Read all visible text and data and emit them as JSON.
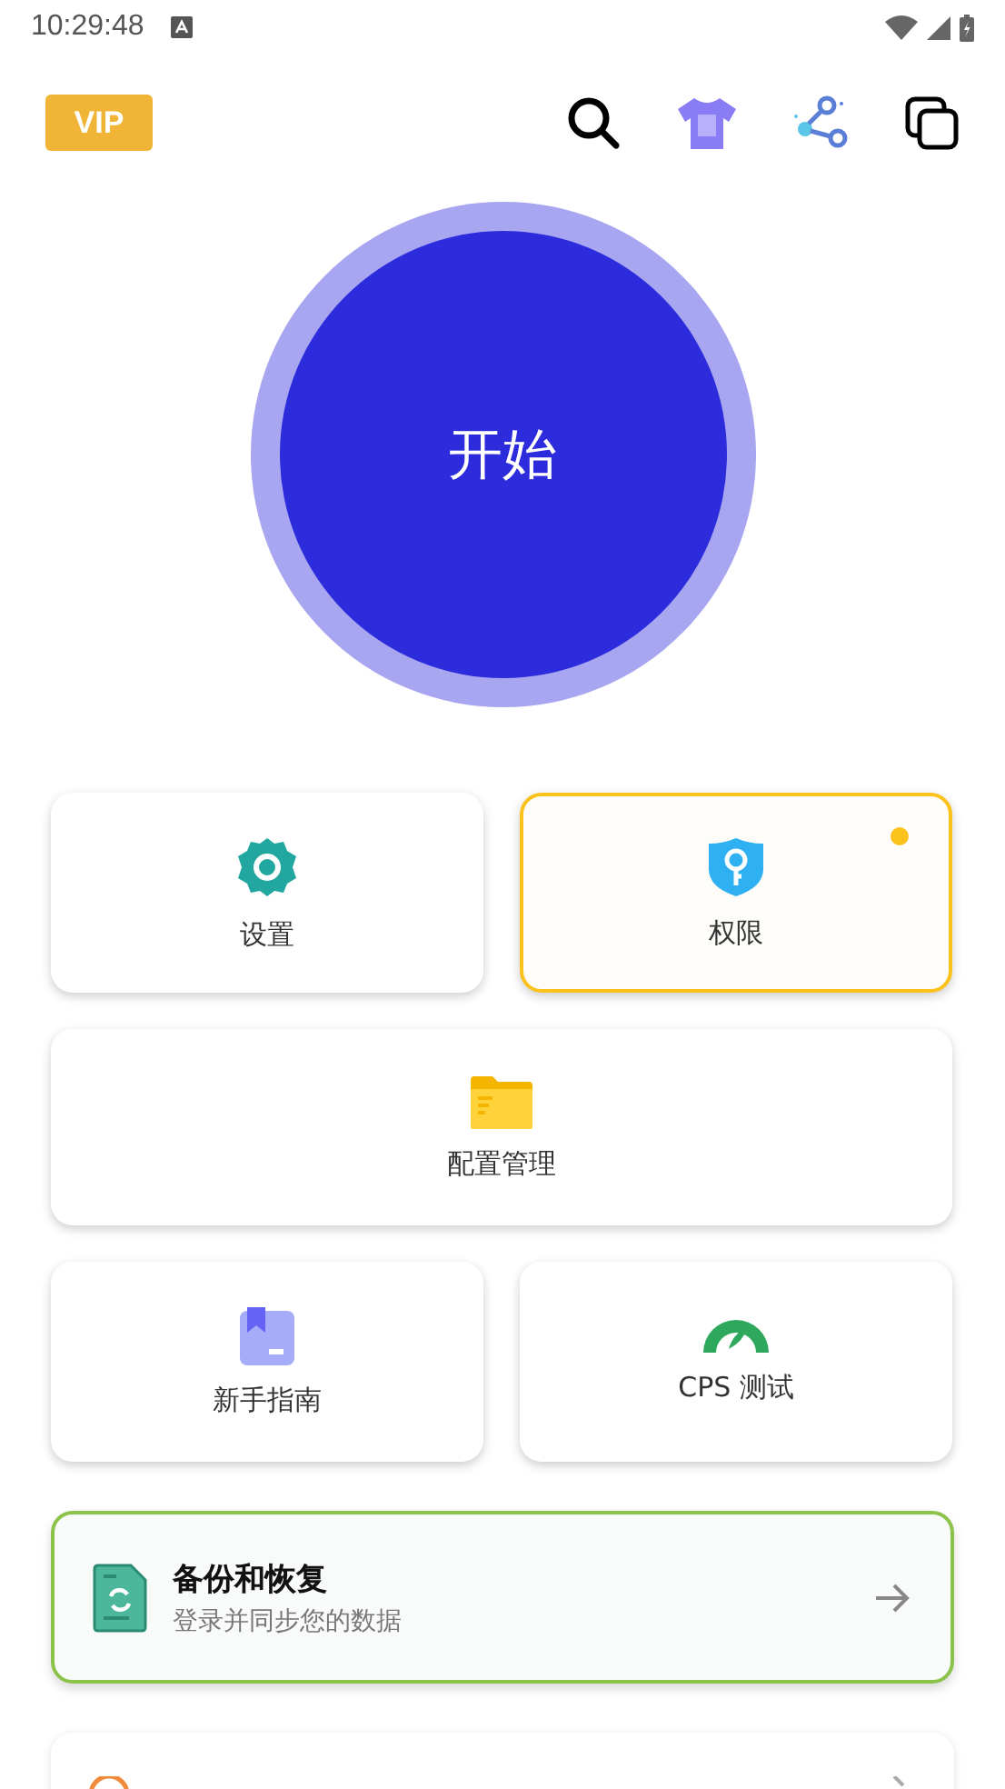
{
  "status_bar": {
    "time": "10:29:48"
  },
  "header": {
    "vip": "VIP"
  },
  "start_button": {
    "label": "开始"
  },
  "tiles": [
    {
      "kind": "settings",
      "label": "设置",
      "selected": false,
      "badge": false,
      "wide": false
    },
    {
      "kind": "permission",
      "label": "权限",
      "selected": true,
      "badge": true,
      "wide": false
    },
    {
      "kind": "config",
      "label": "配置管理",
      "selected": false,
      "badge": false,
      "wide": true
    },
    {
      "kind": "guide",
      "label": "新手指南",
      "selected": false,
      "badge": false,
      "wide": false
    },
    {
      "kind": "cps",
      "label": "CPS 测试",
      "selected": false,
      "badge": false,
      "wide": false
    }
  ],
  "backup_card": {
    "title": "备份和恢复",
    "subtitle": "登录并同步您的数据"
  }
}
